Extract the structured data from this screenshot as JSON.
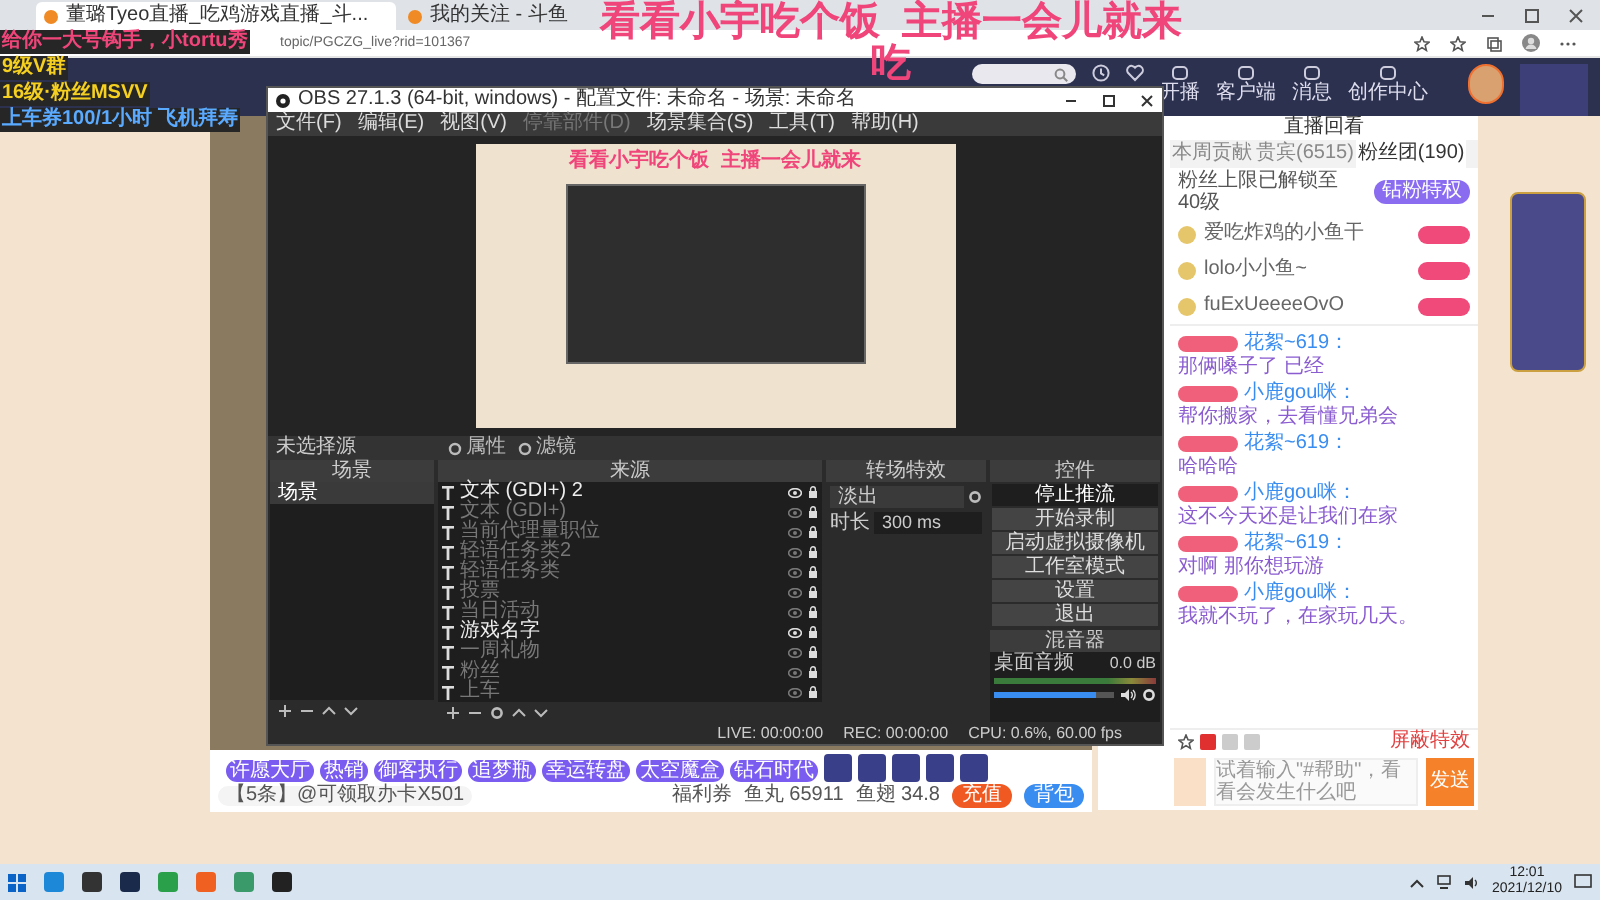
{
  "browser": {
    "tabs": [
      {
        "title": "董璐Tyeo直播_吃鸡游戏直播_斗...",
        "selected": true
      },
      {
        "title": "我的关注 - 斗鱼",
        "selected": false
      }
    ],
    "address": "topic/PGCZG_live?rid=101367"
  },
  "site_nav": {
    "items": [
      {
        "label": "开播"
      },
      {
        "label": "客户端"
      },
      {
        "label": "消息"
      },
      {
        "label": "创作中心"
      }
    ]
  },
  "stream_overlay": {
    "title": "看看小宇吃个饭  主播一会儿就来",
    "title_wrap": "吃",
    "danmaku": [
      {
        "text": "给你一大号钩手，小tortu秀",
        "kind": "highlight"
      },
      {
        "text": "9级V群",
        "kind": "rank"
      },
      {
        "text": "16级·粉丝MSVV",
        "kind": "rank"
      },
      {
        "text": "上车券100/1小时 飞机拜寿",
        "kind": "notice"
      }
    ]
  },
  "obs": {
    "title": "OBS 27.1.3 (64-bit, windows) - 配置文件: 未命名 - 场景: 未命名",
    "menu": [
      {
        "label": "文件(F)",
        "disabled": false
      },
      {
        "label": "编辑(E)",
        "disabled": false
      },
      {
        "label": "视图(V)",
        "disabled": false
      },
      {
        "label": "停靠部件(D)",
        "disabled": true
      },
      {
        "label": "场景集合(S)",
        "disabled": false
      },
      {
        "label": "工具(T)",
        "disabled": false
      },
      {
        "label": "帮助(H)",
        "disabled": false
      }
    ],
    "preview_overlay": "看看小宇吃个饭  主播一会儿就来",
    "source_bar": {
      "label": "未选择源",
      "buttons": [
        "属性",
        "滤镜"
      ]
    },
    "scenes": {
      "title": "场景",
      "items": [
        {
          "name": "场景",
          "selected": true
        }
      ]
    },
    "sources": {
      "title": "来源",
      "items": [
        {
          "name": "文本 (GDI+) 2",
          "visible": true
        },
        {
          "name": "文本 (GDI+)",
          "visible": false
        },
        {
          "name": "当前代理量职位",
          "visible": false
        },
        {
          "name": "轻语任务类2",
          "visible": false
        },
        {
          "name": "轻语任务类",
          "visible": false
        },
        {
          "name": "投票",
          "visible": false
        },
        {
          "name": "当日活动",
          "visible": false
        },
        {
          "name": "游戏名字",
          "visible": true
        },
        {
          "name": "一周礼物",
          "visible": false
        },
        {
          "name": "粉丝",
          "visible": false
        },
        {
          "name": "上车",
          "visible": false
        }
      ]
    },
    "transitions": {
      "title": "转场特效",
      "selected": "淡出",
      "duration_label": "时长",
      "duration": "300 ms"
    },
    "controls": {
      "title": "控件",
      "buttons": [
        {
          "label": "停止推流",
          "active": true
        },
        {
          "label": "开始录制",
          "active": false
        },
        {
          "label": "启动虚拟摄像机",
          "active": false
        },
        {
          "label": "工作室模式",
          "active": false
        },
        {
          "label": "设置",
          "active": false
        },
        {
          "label": "退出",
          "active": false
        }
      ]
    },
    "mixer": {
      "title": "混音器",
      "channel": "桌面音频",
      "reading": "0.0 dB",
      "level": 0.85
    },
    "status": [
      {
        "text": "LIVE: 00:00:00"
      },
      {
        "text": "REC: 00:00:00"
      },
      {
        "text": "CPU: 0.6%, 60.00 fps"
      }
    ]
  },
  "room_bar": {
    "gifts": [
      {
        "label": "许愿大厅"
      },
      {
        "label": "热销"
      },
      {
        "label": "御客执行"
      },
      {
        "label": "追梦瓶"
      },
      {
        "label": "幸运转盘"
      },
      {
        "label": "太空魔盒"
      },
      {
        "label": "钻石时代"
      }
    ],
    "notice": "【5条】@可领取办卡X501",
    "coupon": "福利券",
    "fish_balls": "鱼丸 65911",
    "fish_fins": "鱼翅 34.8",
    "buttons": [
      {
        "label": "充值",
        "kind": "primary"
      },
      {
        "label": "背包",
        "kind": "secondary"
      }
    ]
  },
  "chat": {
    "header": "直播回看",
    "tabs": [
      {
        "label": "本周贡献",
        "selected": false
      },
      {
        "label": "贵宾(6515)",
        "selected": false
      },
      {
        "label": "粉丝团(190)",
        "selected": true
      }
    ],
    "notice": "粉丝上限已解锁至40级",
    "notice_button": "钻粉特权",
    "fans": [
      {
        "name": "爱吃炸鸡的小鱼干"
      },
      {
        "name": "lolo小小鱼~"
      },
      {
        "name": "fuExUeeeeOvO"
      }
    ],
    "messages": [
      {
        "user": "花絮~619：",
        "text": "那俩嗓子了 已经"
      },
      {
        "user": "小鹿gou咪：",
        "text": "帮你搬家，去看懂兄弟会"
      },
      {
        "user": "花絮~619：",
        "text": "哈哈哈"
      },
      {
        "user": "小鹿gou咪：",
        "text": "这不今天还是让我们在家"
      },
      {
        "user": "花絮~619：",
        "text": "对啊 那你想玩游"
      },
      {
        "user": "小鹿gou咪：",
        "text": "我就不玩了，在家玩几天。"
      }
    ],
    "effects_toggle": "屏蔽特效",
    "input_placeholder": "试着输入\"#帮助\"，看看会发生什么吧",
    "send": "发送"
  },
  "taskbar": {
    "time": "12:01",
    "date": "2021/12/10"
  }
}
